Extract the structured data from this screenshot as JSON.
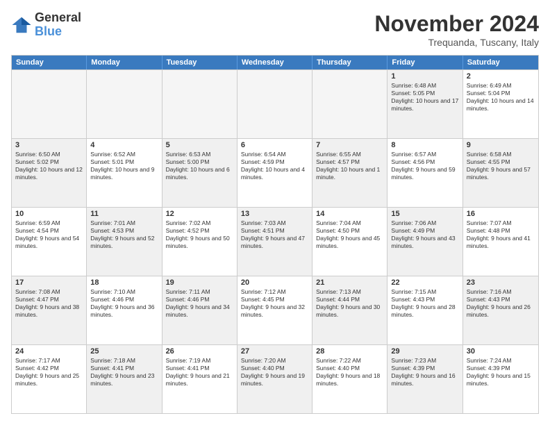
{
  "header": {
    "logo_line1": "General",
    "logo_line2": "Blue",
    "month_title": "November 2024",
    "subtitle": "Trequanda, Tuscany, Italy"
  },
  "weekdays": [
    "Sunday",
    "Monday",
    "Tuesday",
    "Wednesday",
    "Thursday",
    "Friday",
    "Saturday"
  ],
  "weeks": [
    [
      {
        "day": "",
        "info": "",
        "empty": true
      },
      {
        "day": "",
        "info": "",
        "empty": true
      },
      {
        "day": "",
        "info": "",
        "empty": true
      },
      {
        "day": "",
        "info": "",
        "empty": true
      },
      {
        "day": "",
        "info": "",
        "empty": true
      },
      {
        "day": "1",
        "info": "Sunrise: 6:48 AM\nSunset: 5:05 PM\nDaylight: 10 hours and 17 minutes.",
        "empty": false,
        "shaded": true
      },
      {
        "day": "2",
        "info": "Sunrise: 6:49 AM\nSunset: 5:04 PM\nDaylight: 10 hours and 14 minutes.",
        "empty": false,
        "shaded": false
      }
    ],
    [
      {
        "day": "3",
        "info": "Sunrise: 6:50 AM\nSunset: 5:02 PM\nDaylight: 10 hours and 12 minutes.",
        "empty": false,
        "shaded": true
      },
      {
        "day": "4",
        "info": "Sunrise: 6:52 AM\nSunset: 5:01 PM\nDaylight: 10 hours and 9 minutes.",
        "empty": false,
        "shaded": false
      },
      {
        "day": "5",
        "info": "Sunrise: 6:53 AM\nSunset: 5:00 PM\nDaylight: 10 hours and 6 minutes.",
        "empty": false,
        "shaded": true
      },
      {
        "day": "6",
        "info": "Sunrise: 6:54 AM\nSunset: 4:59 PM\nDaylight: 10 hours and 4 minutes.",
        "empty": false,
        "shaded": false
      },
      {
        "day": "7",
        "info": "Sunrise: 6:55 AM\nSunset: 4:57 PM\nDaylight: 10 hours and 1 minute.",
        "empty": false,
        "shaded": true
      },
      {
        "day": "8",
        "info": "Sunrise: 6:57 AM\nSunset: 4:56 PM\nDaylight: 9 hours and 59 minutes.",
        "empty": false,
        "shaded": false
      },
      {
        "day": "9",
        "info": "Sunrise: 6:58 AM\nSunset: 4:55 PM\nDaylight: 9 hours and 57 minutes.",
        "empty": false,
        "shaded": true
      }
    ],
    [
      {
        "day": "10",
        "info": "Sunrise: 6:59 AM\nSunset: 4:54 PM\nDaylight: 9 hours and 54 minutes.",
        "empty": false,
        "shaded": false
      },
      {
        "day": "11",
        "info": "Sunrise: 7:01 AM\nSunset: 4:53 PM\nDaylight: 9 hours and 52 minutes.",
        "empty": false,
        "shaded": true
      },
      {
        "day": "12",
        "info": "Sunrise: 7:02 AM\nSunset: 4:52 PM\nDaylight: 9 hours and 50 minutes.",
        "empty": false,
        "shaded": false
      },
      {
        "day": "13",
        "info": "Sunrise: 7:03 AM\nSunset: 4:51 PM\nDaylight: 9 hours and 47 minutes.",
        "empty": false,
        "shaded": true
      },
      {
        "day": "14",
        "info": "Sunrise: 7:04 AM\nSunset: 4:50 PM\nDaylight: 9 hours and 45 minutes.",
        "empty": false,
        "shaded": false
      },
      {
        "day": "15",
        "info": "Sunrise: 7:06 AM\nSunset: 4:49 PM\nDaylight: 9 hours and 43 minutes.",
        "empty": false,
        "shaded": true
      },
      {
        "day": "16",
        "info": "Sunrise: 7:07 AM\nSunset: 4:48 PM\nDaylight: 9 hours and 41 minutes.",
        "empty": false,
        "shaded": false
      }
    ],
    [
      {
        "day": "17",
        "info": "Sunrise: 7:08 AM\nSunset: 4:47 PM\nDaylight: 9 hours and 38 minutes.",
        "empty": false,
        "shaded": true
      },
      {
        "day": "18",
        "info": "Sunrise: 7:10 AM\nSunset: 4:46 PM\nDaylight: 9 hours and 36 minutes.",
        "empty": false,
        "shaded": false
      },
      {
        "day": "19",
        "info": "Sunrise: 7:11 AM\nSunset: 4:46 PM\nDaylight: 9 hours and 34 minutes.",
        "empty": false,
        "shaded": true
      },
      {
        "day": "20",
        "info": "Sunrise: 7:12 AM\nSunset: 4:45 PM\nDaylight: 9 hours and 32 minutes.",
        "empty": false,
        "shaded": false
      },
      {
        "day": "21",
        "info": "Sunrise: 7:13 AM\nSunset: 4:44 PM\nDaylight: 9 hours and 30 minutes.",
        "empty": false,
        "shaded": true
      },
      {
        "day": "22",
        "info": "Sunrise: 7:15 AM\nSunset: 4:43 PM\nDaylight: 9 hours and 28 minutes.",
        "empty": false,
        "shaded": false
      },
      {
        "day": "23",
        "info": "Sunrise: 7:16 AM\nSunset: 4:43 PM\nDaylight: 9 hours and 26 minutes.",
        "empty": false,
        "shaded": true
      }
    ],
    [
      {
        "day": "24",
        "info": "Sunrise: 7:17 AM\nSunset: 4:42 PM\nDaylight: 9 hours and 25 minutes.",
        "empty": false,
        "shaded": false
      },
      {
        "day": "25",
        "info": "Sunrise: 7:18 AM\nSunset: 4:41 PM\nDaylight: 9 hours and 23 minutes.",
        "empty": false,
        "shaded": true
      },
      {
        "day": "26",
        "info": "Sunrise: 7:19 AM\nSunset: 4:41 PM\nDaylight: 9 hours and 21 minutes.",
        "empty": false,
        "shaded": false
      },
      {
        "day": "27",
        "info": "Sunrise: 7:20 AM\nSunset: 4:40 PM\nDaylight: 9 hours and 19 minutes.",
        "empty": false,
        "shaded": true
      },
      {
        "day": "28",
        "info": "Sunrise: 7:22 AM\nSunset: 4:40 PM\nDaylight: 9 hours and 18 minutes.",
        "empty": false,
        "shaded": false
      },
      {
        "day": "29",
        "info": "Sunrise: 7:23 AM\nSunset: 4:39 PM\nDaylight: 9 hours and 16 minutes.",
        "empty": false,
        "shaded": true
      },
      {
        "day": "30",
        "info": "Sunrise: 7:24 AM\nSunset: 4:39 PM\nDaylight: 9 hours and 15 minutes.",
        "empty": false,
        "shaded": false
      }
    ]
  ]
}
